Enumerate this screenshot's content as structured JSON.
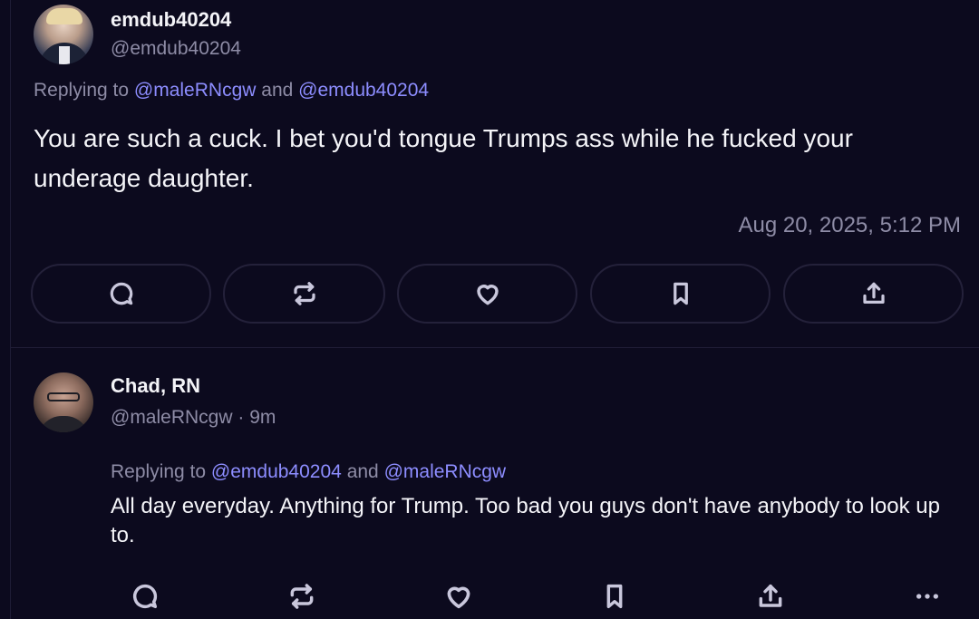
{
  "main_post": {
    "display_name": "emdub40204",
    "handle": "@emdub40204",
    "replying_prefix": "Replying to",
    "replying_to_1": "@maleRNcgw",
    "replying_and": "and",
    "replying_to_2": "@emdub40204",
    "text": "You are such a cuck. I bet you'd tongue Trumps ass while he fucked your underage daughter.",
    "timestamp": "Aug 20, 2025, 5:12 PM",
    "actions": [
      "reply-icon",
      "repost-icon",
      "like-icon",
      "bookmark-icon",
      "share-icon"
    ]
  },
  "reply_post": {
    "display_name": "Chad, RN",
    "handle": "@maleRNcgw",
    "separator": "·",
    "age": "9m",
    "replying_prefix": "Replying to",
    "replying_to_1": "@emdub40204",
    "replying_and": "and",
    "replying_to_2": "@maleRNcgw",
    "text": "All day everyday. Anything for Trump. Too bad you guys don't have anybody to look up to.",
    "actions": [
      "reply-icon",
      "repost-icon",
      "like-icon",
      "bookmark-icon",
      "share-icon",
      "more-icon"
    ]
  },
  "colors": {
    "background": "#0c0a1e",
    "text": "#f4f4f8",
    "muted": "#8e8ca6",
    "mention": "#8d8dff",
    "border": "#24213a"
  }
}
